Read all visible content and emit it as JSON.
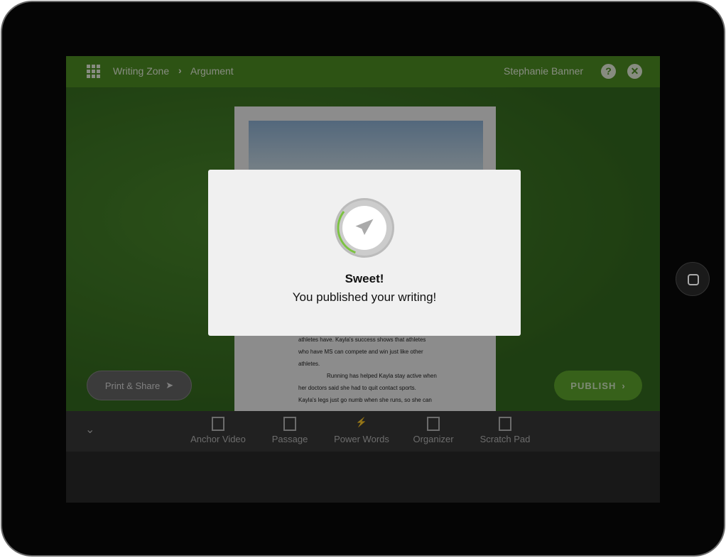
{
  "header": {
    "breadcrumb": [
      "Writing Zone",
      "Argument"
    ],
    "user": "Stephanie Banner"
  },
  "document": {
    "lines": [
      "athletes have. Kayla's success shows that athletes",
      "who have MS can compete and win just like other",
      "athletes.",
      "Running has helped Kayla stay active when",
      "her doctors said she had to quit contact sports.",
      "Kayla's legs just go numb when she runs, so she can"
    ]
  },
  "buttons": {
    "print_share": "Print & Share",
    "publish": "PUBLISH"
  },
  "toolbar": {
    "items": [
      "Anchor Video",
      "Passage",
      "Power Words",
      "Organizer",
      "Scratch Pad"
    ]
  },
  "modal": {
    "title": "Sweet!",
    "message": "You published your writing!",
    "progress": 0.3
  },
  "colors": {
    "brand": "#4e8f24",
    "accent": "#7cc242"
  }
}
